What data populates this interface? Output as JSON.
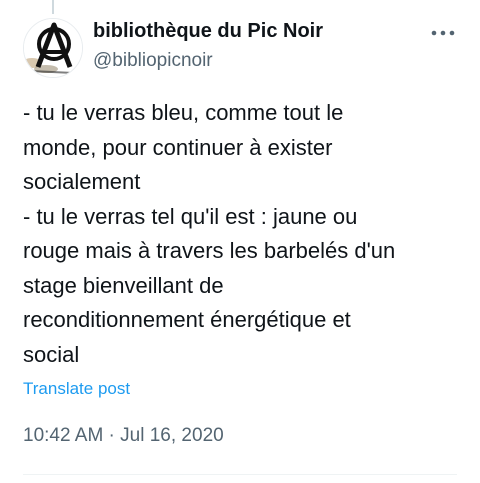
{
  "tweet": {
    "author": {
      "display_name": "bibliothèque du Pic Noir",
      "handle": "@bibliopicnoir",
      "avatar_icon": "anarchy-symbol-icon"
    },
    "more_icon": "more-horizontal-icon",
    "text_lines": [
      "- tu le verras bleu, comme tout le",
      "monde, pour continuer à exister",
      "socialement",
      "- tu le verras tel qu'il est : jaune ou",
      "rouge mais à travers les barbelés d'un",
      "stage bienveillant de",
      "reconditionnement énergétique et",
      "social"
    ],
    "translate_label": "Translate post",
    "time": "10:42 AM",
    "separator": " · ",
    "date": "Jul 16, 2020"
  },
  "colors": {
    "text_primary": "#0f1419",
    "text_secondary": "#536471",
    "link": "#1d9bf0",
    "divider": "#eff3f4"
  }
}
